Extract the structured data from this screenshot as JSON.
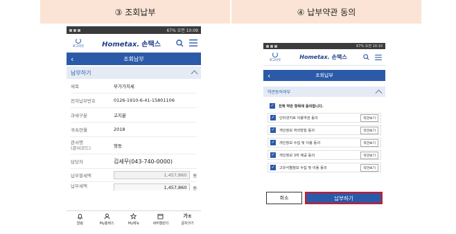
{
  "steps": [
    "③ 조회납부",
    "④ 납부약관 동의"
  ],
  "status_bar": {
    "left": {
      "time": "오전 10:09",
      "battery": "67%"
    },
    "right": {
      "time": "오전 10:10",
      "battery": "67%"
    }
  },
  "app": {
    "logout_label": "로그아웃",
    "brand_en": "Hometax.",
    "brand_ko": "손택스"
  },
  "screen1": {
    "title": "조회납부",
    "section": "납부하기",
    "rows": [
      {
        "label": "세목",
        "value": "부가가치세"
      },
      {
        "label": "전자납부번호",
        "value": "0126-1910-6-41-15801106"
      },
      {
        "label": "과세구분",
        "value": "고지분"
      },
      {
        "label": "귀속연월",
        "value": "2018"
      },
      {
        "label": "관서명\n(관서코드)",
        "value": "영동"
      },
      {
        "label": "담당자",
        "value": "김세무(043-740-0000)"
      }
    ],
    "amount_label": "납부할세액",
    "amount": "1,457,860",
    "amount2_label": "납부세액",
    "amount2": "1,457,860",
    "currency": "원",
    "nav": [
      "알림",
      "My홈택스",
      "My메뉴",
      "세무캘린더",
      "글자크기"
    ],
    "nav_font_glyph": "가±"
  },
  "screen2": {
    "title": "조회납부",
    "section": "약관동의여부",
    "agree_all": "전체 약관 항목에 동의합니다.",
    "view_label": "약관보기",
    "terms": [
      "인터넷지로 이용약관 동의",
      "개인정보 처리방침 동의",
      "개인정보 수집 및 이용 동의",
      "개인정보 3자 제공 동의",
      "고유식별정보 수집 및 이용 동의"
    ],
    "cancel": "취소",
    "pay": "납부하기"
  },
  "colors": {
    "brand_blue": "#2b5aa8",
    "step_bg": "#fbe4d5",
    "highlight_red": "#d6161f"
  }
}
